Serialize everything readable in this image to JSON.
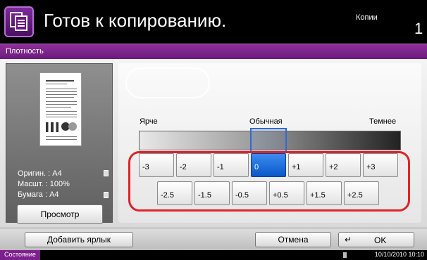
{
  "header": {
    "title": "Готов к копированию.",
    "mode": "Копии",
    "count": "1",
    "icon": "copy-icon"
  },
  "titlebar": {
    "label": "Плотность"
  },
  "preview": {
    "original": "Оригин.   : A4",
    "scale": "Масшт.   : 100%",
    "paper": "Бумага   : A4",
    "button_label": "Просмотр"
  },
  "density": {
    "lighter_label": "Ярче",
    "normal_label": "Обычная",
    "darker_label": "Темнее",
    "selected": "0",
    "row1": [
      "-3",
      "-2",
      "-1",
      "0",
      "+1",
      "+2",
      "+3"
    ],
    "row2": [
      "-2.5",
      "-1.5",
      "-0.5",
      "+0.5",
      "+1.5",
      "+2.5"
    ]
  },
  "footer": {
    "add_label_button": "Добавить ярлык",
    "cancel_button": "Отмена",
    "ok_button": "OK"
  },
  "status": {
    "label": "Состояние",
    "datetime": "10/10/2010  10:10"
  },
  "colors": {
    "accent": "#7d1f8d",
    "selected_step": "#0a58c9",
    "highlight_frame": "#e0222a"
  }
}
